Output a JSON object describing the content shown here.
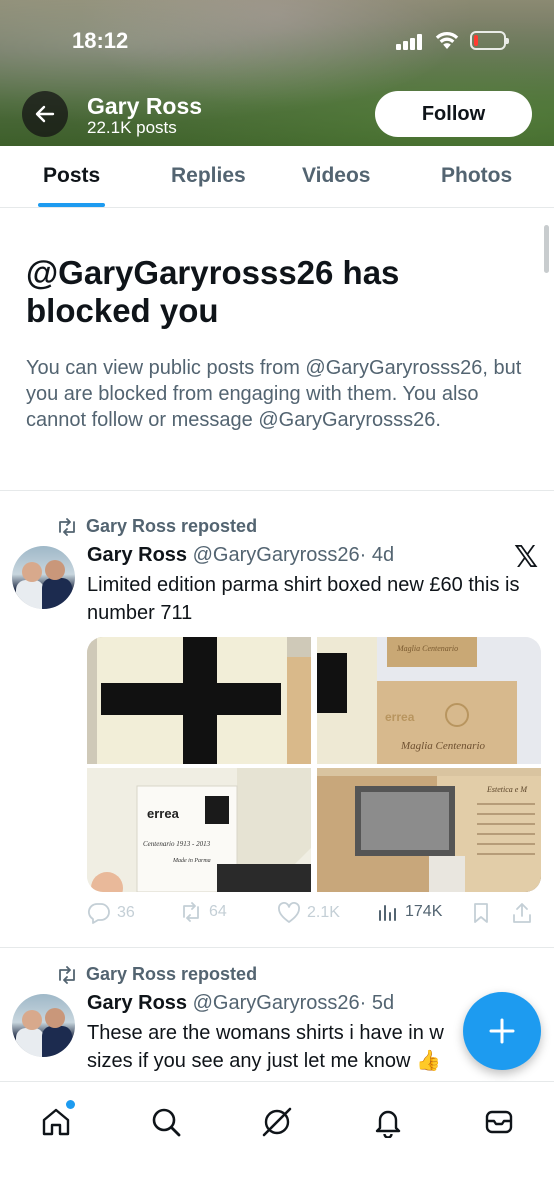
{
  "status_bar": {
    "time": "18:12",
    "battery_level": 0.15,
    "battery_color": "#ff3b30"
  },
  "header": {
    "name": "Gary Ross",
    "posts_count": "22.1K posts",
    "follow_label": "Follow"
  },
  "tabs": [
    {
      "label": "Posts",
      "active": true
    },
    {
      "label": "Replies",
      "active": false
    },
    {
      "label": "Videos",
      "active": false
    },
    {
      "label": "Photos",
      "active": false
    }
  ],
  "blocked": {
    "title": "@GaryGaryrosss26 has blocked you",
    "text": "You can view public posts from @GaryGaryrosss26, but you are blocked from engaging with them. You also cannot follow or message @GaryGaryrosss26."
  },
  "posts": [
    {
      "repost_label": "Gary Ross reposted",
      "name": "Gary Ross",
      "handle": "@GaryGaryross26",
      "time": "· 4d",
      "text": "Limited edition parma shirt boxed new £60 this is number 711",
      "media_captions": [
        "errea",
        "Maglia Centenario",
        "Centenario 1913 - 2013",
        "Made in Parma",
        "Estetica e M"
      ],
      "stats": {
        "replies": "36",
        "reposts": "64",
        "likes": "2.1K",
        "views": "174K"
      }
    },
    {
      "repost_label": "Gary Ross reposted",
      "name": "Gary Ross",
      "handle": "@GaryGaryross26",
      "time": "· 5d",
      "text": "These are the womans shirts i have in w",
      "text_line2": "sizes if you see any just let me know 👍"
    }
  ],
  "bottom_nav": [
    "home-icon",
    "search-icon",
    "grok-icon",
    "notifications-icon",
    "messages-icon"
  ],
  "colors": {
    "accent": "#1d9bf0",
    "text_primary": "#0f1419",
    "text_secondary": "#536471"
  }
}
